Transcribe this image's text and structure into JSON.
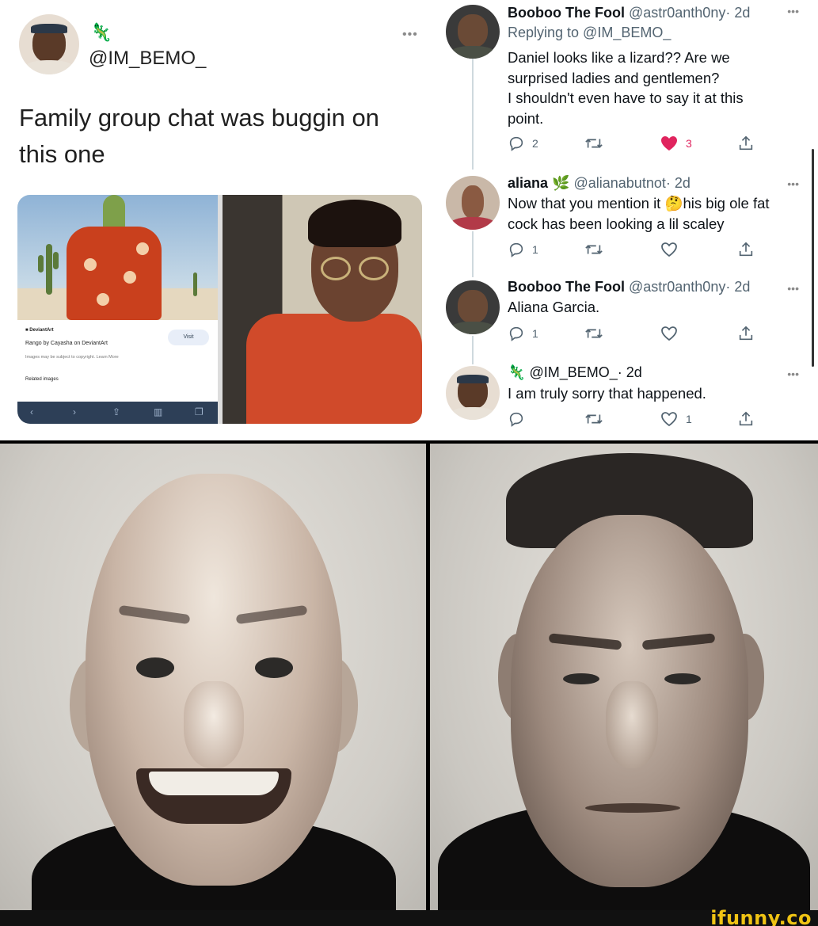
{
  "left_tweet": {
    "handle": "@IM_BEMO_",
    "name_emoji": "🦎",
    "more": "•••",
    "text_line1": "Family group chat was buggin on",
    "text_line2": "this one",
    "media": {
      "left": {
        "source_label": "DeviantArt",
        "title": "Rango by Cayasha on DeviantArt",
        "copyright": "Images may be subject to copyright. Learn More",
        "visit": "Visit",
        "related": "Related images"
      }
    }
  },
  "thread": {
    "replies": [
      {
        "name": "Booboo The Fool",
        "handle": "@astr0anth0ny",
        "time": "· 2d",
        "replying_to": "Replying to @IM_BEMO_",
        "text": [
          "Daniel looks like a lizard?? Are we",
          "surprised ladies and gentlemen?",
          "I shouldn't even have to say it at this",
          "point."
        ],
        "replies": "2",
        "likes": "3",
        "liked": true
      },
      {
        "name": "aliana",
        "name_emoji": "🌿",
        "handle": "@alianabutnot",
        "time": "· 2d",
        "text": [
          "Now that you mention it 🤔his big ole fat",
          "cock has been looking a lil scaley"
        ],
        "replies": "1",
        "likes": ""
      },
      {
        "name": "Booboo The Fool",
        "handle": "@astr0anth0ny",
        "time": "· 2d",
        "text": [
          "Aliana Garcia."
        ],
        "replies": "1",
        "likes": ""
      },
      {
        "name_emoji": "🦎",
        "handle": "@IM_BEMO_",
        "time": "· 2d",
        "text": [
          "I am truly sorry that happened."
        ],
        "replies": "",
        "likes": "1"
      }
    ],
    "more": "•••"
  },
  "watermark": "ifunny.co",
  "colors": {
    "like_red": "#e0245e",
    "secondary_text": "#536471",
    "watermark_yellow": "#f0c414"
  }
}
